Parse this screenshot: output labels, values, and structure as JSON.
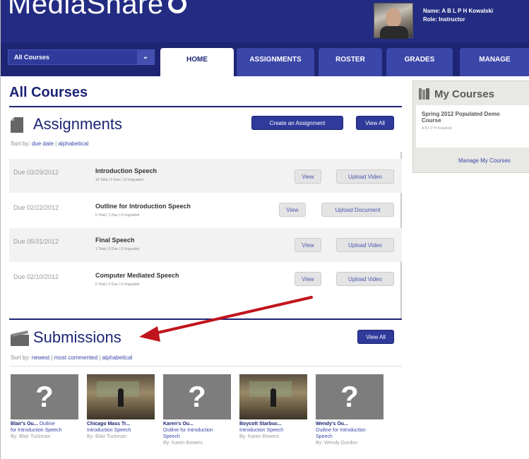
{
  "header": {
    "logo_text": "MediaShare",
    "user_name": "Name: A B L P H Kowalski",
    "user_role": "Role: Instructor"
  },
  "nav": {
    "course_select": "All Courses",
    "tabs": [
      {
        "label": "HOME",
        "active": true
      },
      {
        "label": "ASSIGNMENTS",
        "active": false
      },
      {
        "label": "ROSTER",
        "active": false
      },
      {
        "label": "GRADES",
        "active": false
      },
      {
        "label": "MANAGE",
        "active": false
      }
    ]
  },
  "page_title": "All Courses",
  "assignments": {
    "title": "Assignments",
    "create_label": "Create an Assignment",
    "view_all_label": "View All",
    "sort_prefix": "Sort by:",
    "sort_options": [
      "due date",
      "alphabetical"
    ],
    "rows": [
      {
        "due": "Due 03/29/2012",
        "title": "Introduction Speech",
        "stats": "16 Total | 0 Due | 13 Ungraded",
        "view": "View",
        "action": "Upload Video"
      },
      {
        "due": "Due 02/22/2012",
        "title": "Outline for Introduction Speech",
        "stats": "5 Total | 1 Due | 3 Ungraded",
        "view": "View",
        "action": "Upload Document"
      },
      {
        "due": "Due 05/31/2012",
        "title": "Final Speech",
        "stats": "1 Total | 5 Due | 0 Ungraded",
        "view": "View",
        "action": "Upload Video"
      },
      {
        "due": "Due 02/10/2012",
        "title": "Computer Mediated Speech",
        "stats": "0 Total | 6 Due | 0 Ungraded",
        "view": "View",
        "action": "Upload Video"
      }
    ]
  },
  "submissions": {
    "title": "Submissions",
    "view_all_label": "View All",
    "sort_prefix": "Sort by:",
    "sort_options": [
      "newest",
      "most commented",
      "alphabetical"
    ],
    "cards": [
      {
        "thumb": "placeholder",
        "name": "Blair's Ou...",
        "assignment_inline": "Outline",
        "assignment": "for Introduction Speech",
        "by": "By: Blair Tuckman"
      },
      {
        "thumb": "photo",
        "name": "Chicago Mass Tr...",
        "assignment_inline": "",
        "assignment": "Introduction Speech",
        "by": "By: Blair Tuckman"
      },
      {
        "thumb": "placeholder",
        "name": "Karen's Ou...",
        "assignment_inline": "",
        "assignment": "Outline for Introduction Speech",
        "by": "By: Karen Bowers"
      },
      {
        "thumb": "photo",
        "name": "Boycott Starbuc...",
        "assignment_inline": "",
        "assignment": "Introduction Speech",
        "by": "By: Karen Bowers"
      },
      {
        "thumb": "placeholder",
        "name": "Wendy's Ou...",
        "assignment_inline": "",
        "assignment": "Outline for Introduction Speech",
        "by": "By: Wendy Gordon"
      }
    ]
  },
  "sidebar": {
    "title": "My Courses",
    "course_name": "Spring 2012 Populated Demo Course",
    "course_instructor": "A B L P H Kowalski",
    "manage_link": "Manage My Courses"
  },
  "colors": {
    "navy": "#1d2574",
    "accent_blue": "#2f3a9b",
    "annotation_arrow": "#c0141c"
  }
}
